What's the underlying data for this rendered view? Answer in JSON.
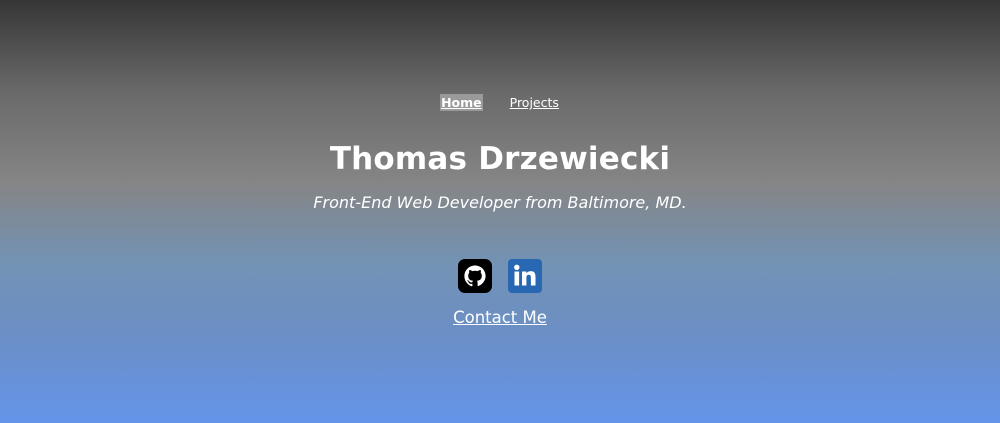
{
  "nav": {
    "items": [
      {
        "label": "Home",
        "active": true
      },
      {
        "label": "Projects",
        "active": false
      }
    ]
  },
  "hero": {
    "name": "Thomas Drzewiecki",
    "tagline": "Front-End Web Developer from Baltimore, MD."
  },
  "socials": [
    {
      "icon": "github-icon"
    },
    {
      "icon": "linkedin-icon"
    }
  ],
  "contact": {
    "label": "Contact Me"
  },
  "colors": {
    "gradient_top": "#363636",
    "gradient_mid": "#858585",
    "gradient_bottom": "#6494ea",
    "text": "#ffffff",
    "active_nav_bg": "#9a9a9a",
    "linkedin_blue": "#2867b2"
  }
}
